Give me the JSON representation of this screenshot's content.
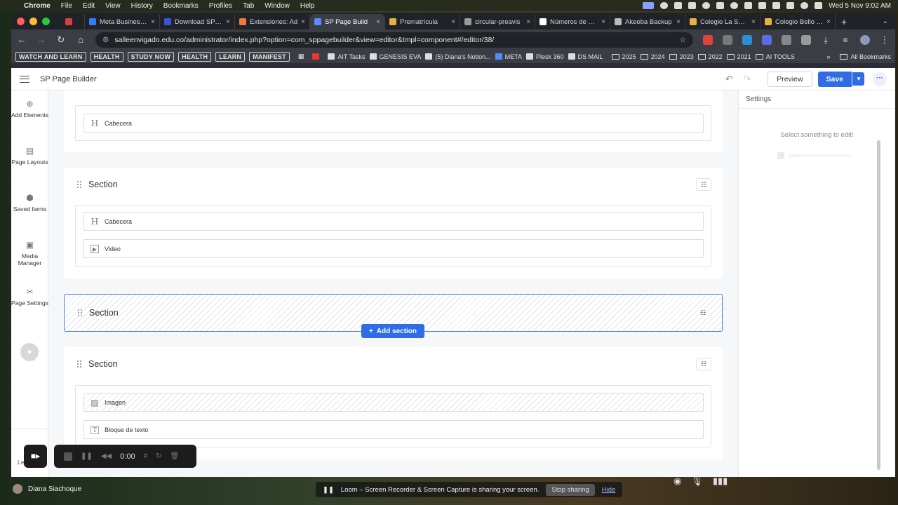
{
  "menubar": {
    "app": "Chrome",
    "items": [
      "File",
      "Edit",
      "View",
      "History",
      "Bookmarks",
      "Profiles",
      "Tab",
      "Window",
      "Help"
    ],
    "clock": "Wed 5 Nov  9:02 AM"
  },
  "tabs": [
    {
      "title": "",
      "color": "#d84040"
    },
    {
      "title": "Meta Business S",
      "color": "#2d7ff9"
    },
    {
      "title": "Download SP Pa",
      "color": "#3656d8"
    },
    {
      "title": "Extensiones: Ad",
      "color": "#f27a3b"
    },
    {
      "title": "SP Page Build",
      "color": "#5a8cff",
      "active": true
    },
    {
      "title": "Prematrícula",
      "color": "#e2b23a"
    },
    {
      "title": "circular-preavis",
      "color": "#9a9a9a"
    },
    {
      "title": "Números de Gra",
      "color": "#ffffff"
    },
    {
      "title": "Akeeba Backup",
      "color": "#bbbbbb"
    },
    {
      "title": "Colegio La Salle",
      "color": "#e6b43c"
    },
    {
      "title": "Colegio Bello La",
      "color": "#e6b43c"
    }
  ],
  "omnibox": {
    "url": "salleenvigado.edu.co/administrator/index.php?option=com_sppagebuilder&view=editor&tmpl=component#/editor/38/"
  },
  "bookmarks": {
    "pills": [
      "WATCH AND LEARN",
      "HEALTH",
      "STUDY NOW",
      "HEALTH",
      "LEARN",
      "MANIFEST"
    ],
    "links": [
      {
        "label": "AIT Tasks",
        "color": "#dddddd"
      },
      {
        "label": "GENESIS EVA",
        "color": "#dddddd"
      },
      {
        "label": "(5) Diana's Notion...",
        "color": "#dddddd"
      },
      {
        "label": "META",
        "color": "#4f8cff"
      },
      {
        "label": "Plesk 360",
        "color": "#dddddd"
      },
      {
        "label": "DS MAIL",
        "color": "#dddddd"
      }
    ],
    "folders": [
      "2025",
      "2024",
      "2023",
      "2022",
      "2021",
      "AI TOOLS"
    ],
    "all": "All Bookmarks"
  },
  "app": {
    "name": "SP Page Builder",
    "preview_label": "Preview",
    "save_label": "Save"
  },
  "leftbar": [
    {
      "label": "Add Elements",
      "icon": "plus-circle-icon",
      "glyph": "⊕"
    },
    {
      "label": "Page Layouts",
      "icon": "layout-icon",
      "glyph": "▤"
    },
    {
      "label": "Saved Items",
      "icon": "box-icon",
      "glyph": "⬢"
    },
    {
      "label": "Media Manager",
      "icon": "image-icon",
      "glyph": "▣"
    },
    {
      "label": "Page Settings",
      "icon": "wrench-icon",
      "glyph": "✂"
    }
  ],
  "leftbar_bottom": "Le",
  "sections": [
    {
      "title": "",
      "elements": [
        {
          "label": "Cabecera",
          "glyph": "H"
        }
      ]
    },
    {
      "title": "Section",
      "elements": [
        {
          "label": "Cabecera",
          "glyph": "H"
        },
        {
          "label": "Video",
          "glyph": "▶"
        }
      ]
    },
    {
      "title": "Section",
      "elements": []
    },
    {
      "title": "Section",
      "elements": [
        {
          "label": "Imagen",
          "glyph": "▨"
        },
        {
          "label": "Bloque de texto",
          "glyph": "T"
        }
      ]
    }
  ],
  "add_section_label": "Add section",
  "settings": {
    "title": "Settings",
    "empty": "Select something to edit!"
  },
  "loom": {
    "time": "0:00",
    "message": "Loom – Screen Recorder & Screen Capture is sharing your screen.",
    "stop_label": "Stop sharing",
    "hide_label": "Hide"
  },
  "user": {
    "name": "Diana Siachoque"
  }
}
